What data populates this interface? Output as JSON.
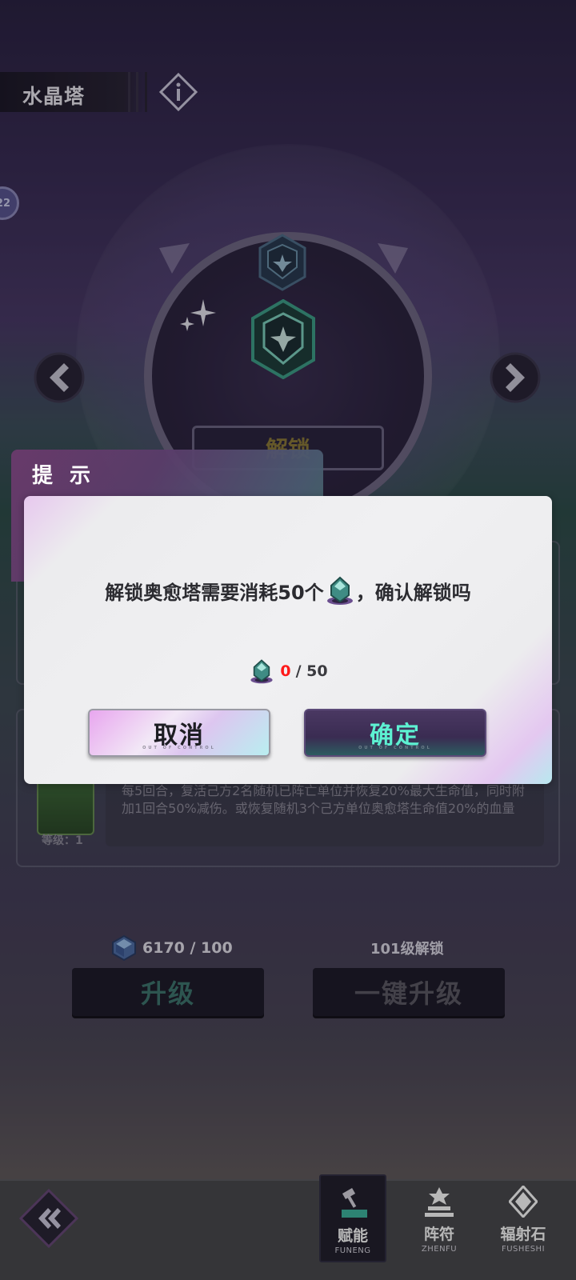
{
  "header": {
    "title": "水晶塔",
    "info_icon": "info-diamond-icon",
    "side_badge": "22"
  },
  "tower": {
    "unlock_label": "解锁"
  },
  "skill": {
    "description": "每5回合，复活己方2名随机已阵亡单位并恢复20%最大生命值，同时附加1回合50%减伤。或恢复随机3个己方单位奥愈塔生命值20%的血量",
    "level_label": "等级：1"
  },
  "upgrade": {
    "crystal_count": "6170 / 100",
    "unlock_level_text": "101级解锁",
    "upgrade_label": "升级",
    "one_key_label": "一键升级"
  },
  "bottom_nav": {
    "tabs": [
      {
        "label": "赋能",
        "sub": "FUNENG",
        "icon": "hammer-anvil-icon",
        "active": true
      },
      {
        "label": "阵符",
        "sub": "ZHENFU",
        "icon": "formation-icon",
        "active": false
      },
      {
        "label": "辐射石",
        "sub": "FUSHESHI",
        "icon": "radiation-stone-icon",
        "active": false
      }
    ]
  },
  "dialog": {
    "title": "提 示",
    "message_before": "解锁奥愈塔需要消耗50个",
    "message_after": "，确认解锁吗",
    "cost_have": "0",
    "cost_sep": " / 50",
    "cancel_label": "取消",
    "confirm_label": "确定",
    "fine_print": "OUT OF CONTROL"
  },
  "colors": {
    "confirm_text": "#5df1d2",
    "insufficient": "#ff1a1a"
  }
}
